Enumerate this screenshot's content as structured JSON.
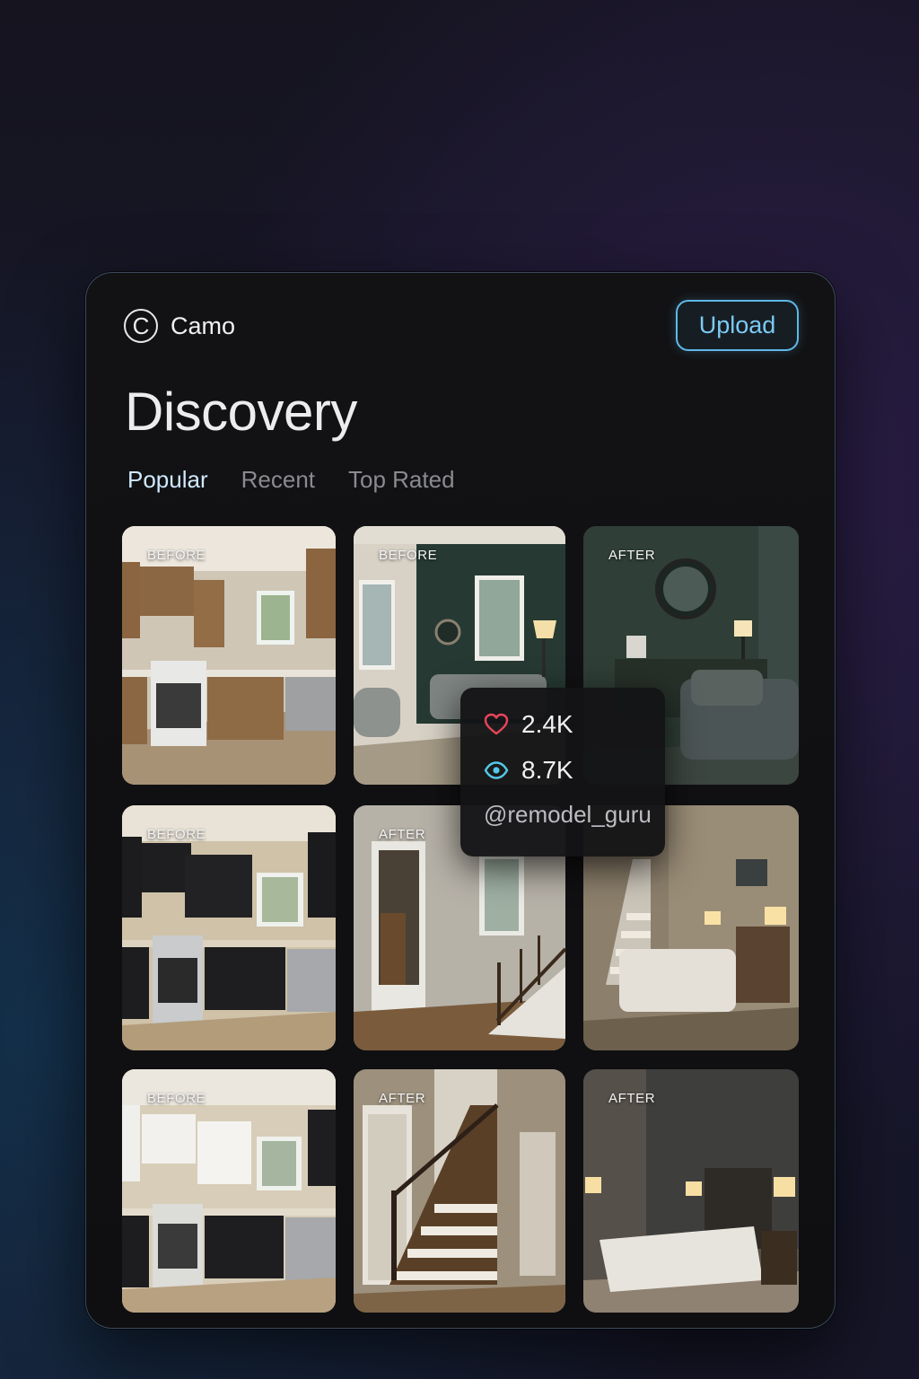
{
  "app": {
    "brand_letter": "C",
    "brand_name": "Camo"
  },
  "header": {
    "upload_label": "Upload"
  },
  "page": {
    "title": "Discovery"
  },
  "tabs": [
    {
      "label": "Popular",
      "active": true
    },
    {
      "label": "Recent",
      "active": false
    },
    {
      "label": "Top Rated",
      "active": false
    }
  ],
  "grid": [
    {
      "tag": "BEFORE",
      "scene": "kitchen-wood"
    },
    {
      "tag": "BEFORE",
      "scene": "living-window"
    },
    {
      "tag": "AFTER",
      "scene": "living-green"
    },
    {
      "tag": "BEFORE",
      "scene": "kitchen-dark"
    },
    {
      "tag": "AFTER",
      "scene": "hallway-stairs"
    },
    {
      "tag": "",
      "scene": "bedroom-stairs"
    },
    {
      "tag": "BEFORE",
      "scene": "kitchen-white"
    },
    {
      "tag": "AFTER",
      "scene": "staircase"
    },
    {
      "tag": "AFTER",
      "scene": "bedroom"
    }
  ],
  "tooltip": {
    "likes": "2.4K",
    "views": "8.7K",
    "user": "@remodel_guru"
  },
  "colors": {
    "accent": "#5fb8e8",
    "heart": "#e8455a",
    "eye": "#52c9e8"
  }
}
